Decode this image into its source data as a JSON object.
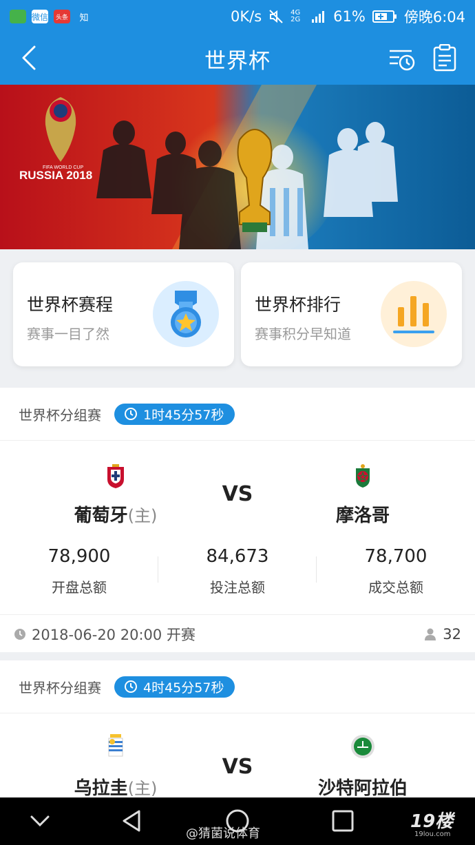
{
  "status_bar": {
    "apps": [
      "微信",
      "头条",
      "知"
    ],
    "network_speed": "0K/s",
    "signal": "4G 2G",
    "battery": "61%",
    "time": "傍晚6:04"
  },
  "header": {
    "title": "世界杯"
  },
  "banner": {
    "logo_caption": "FIFA WORLD CUP",
    "logo_title": "RUSSIA 2018"
  },
  "entries": [
    {
      "title": "世界杯赛程",
      "subtitle": "赛事一目了然",
      "icon": "medal-icon",
      "icon_bg": "#dbeeff"
    },
    {
      "title": "世界杯排行",
      "subtitle": "赛事积分早知道",
      "icon": "bar-chart-icon",
      "icon_bg": "#fff0d8"
    }
  ],
  "matches": [
    {
      "stage": "世界杯分组赛",
      "countdown": "1时45分57秒",
      "home": {
        "name": "葡萄牙",
        "tag": "(主)",
        "flag": "portugal-crest-icon"
      },
      "vs": "VS",
      "away": {
        "name": "摩洛哥",
        "flag": "morocco-crest-icon"
      },
      "stats": [
        {
          "value": "78,900",
          "label": "开盘总额"
        },
        {
          "value": "84,673",
          "label": "投注总额"
        },
        {
          "value": "78,700",
          "label": "成交总额"
        }
      ],
      "kickoff": "2018-06-20 20:00 开赛",
      "participants": "32"
    },
    {
      "stage": "世界杯分组赛",
      "countdown": "4时45分57秒",
      "home": {
        "name": "乌拉圭",
        "tag": "(主)",
        "flag": "uruguay-crest-icon"
      },
      "vs": "VS",
      "away": {
        "name": "沙特阿拉伯",
        "flag": "saudi-crest-icon"
      }
    }
  ],
  "watermark": "@猜菌说体育",
  "site_logo": "19楼",
  "site_logo_sub": "19lou.com",
  "colors": {
    "primary": "#1e8fe0",
    "background": "#eef0f3"
  }
}
